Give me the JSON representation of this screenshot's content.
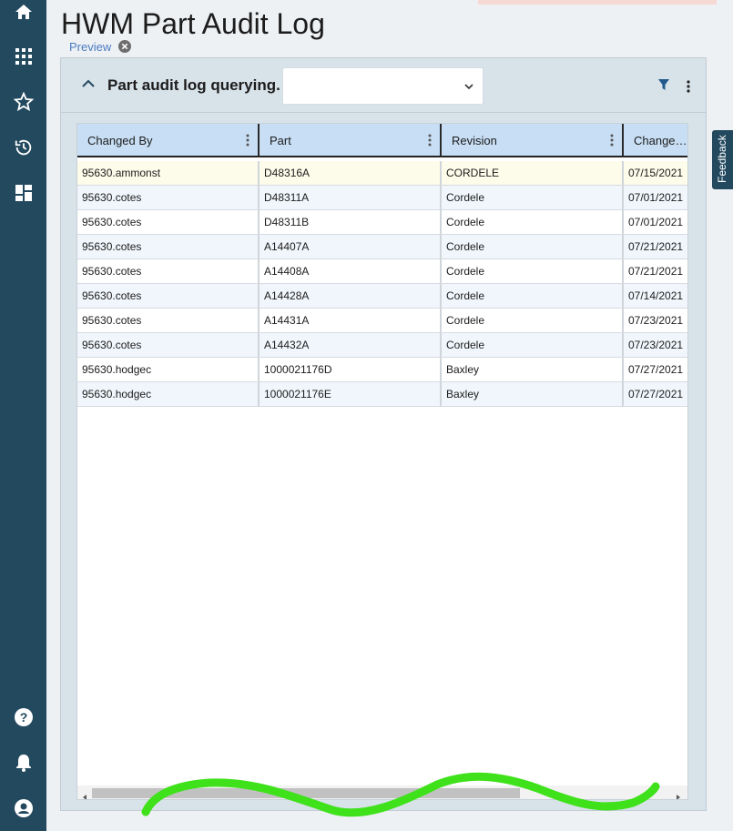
{
  "page": {
    "title": "HWM Part Audit Log",
    "preview_label": "Preview"
  },
  "sidebar": {
    "top_icons": [
      "home-icon",
      "apps-grid-icon",
      "star-icon",
      "history-icon",
      "dashboard-icon"
    ],
    "bottom_icons": [
      "help-icon",
      "bell-icon",
      "user-icon"
    ]
  },
  "panel": {
    "title": "Part audit log querying.",
    "query_select_value": ""
  },
  "grid": {
    "columns": [
      "Changed By",
      "Part",
      "Revision",
      "Change…"
    ],
    "rows": [
      [
        "95630.ammonst",
        "D48316A",
        "CORDELE",
        "07/15/2021"
      ],
      [
        "95630.cotes",
        "D48311A",
        "Cordele",
        "07/01/2021"
      ],
      [
        "95630.cotes",
        "D48311B",
        "Cordele",
        "07/01/2021"
      ],
      [
        "95630.cotes",
        "A14407A",
        "Cordele",
        "07/21/2021"
      ],
      [
        "95630.cotes",
        "A14408A",
        "Cordele",
        "07/21/2021"
      ],
      [
        "95630.cotes",
        "A14428A",
        "Cordele",
        "07/14/2021"
      ],
      [
        "95630.cotes",
        "A14431A",
        "Cordele",
        "07/23/2021"
      ],
      [
        "95630.cotes",
        "A14432A",
        "Cordele",
        "07/23/2021"
      ],
      [
        "95630.hodgec",
        "1000021176D",
        "Baxley",
        "07/27/2021"
      ],
      [
        "95630.hodgec",
        "1000021176E",
        "Baxley",
        "07/27/2021"
      ]
    ]
  },
  "feedback": {
    "label": "Feedback"
  },
  "colors": {
    "sidebar": "#23495f",
    "header_row": "#c7def4",
    "selected_row": "#fdfbea",
    "scribble": "#3fe11b"
  }
}
